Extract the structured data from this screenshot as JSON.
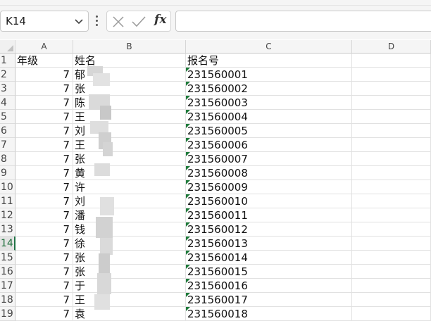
{
  "name_box": {
    "value": "K14"
  },
  "formula_bar": {
    "fx_label": "fx",
    "value": ""
  },
  "columns": [
    "A",
    "B",
    "C",
    "D"
  ],
  "active_row": "14",
  "header_row": {
    "row": "1",
    "a": "年级",
    "b": "姓名",
    "c": "报名号"
  },
  "rows": [
    {
      "row": "2",
      "a": "7",
      "b": "郁",
      "c": "231560001"
    },
    {
      "row": "3",
      "a": "7",
      "b": "张",
      "c": "231560002"
    },
    {
      "row": "4",
      "a": "7",
      "b": "陈",
      "c": "231560003"
    },
    {
      "row": "5",
      "a": "7",
      "b": "王",
      "c": "231560004"
    },
    {
      "row": "6",
      "a": "7",
      "b": "刘",
      "c": "231560005"
    },
    {
      "row": "7",
      "a": "7",
      "b": "王",
      "c": "231560006"
    },
    {
      "row": "8",
      "a": "7",
      "b": "张",
      "c": "231560007"
    },
    {
      "row": "9",
      "a": "7",
      "b": "黄",
      "c": "231560008"
    },
    {
      "row": "10",
      "a": "7",
      "b": "许",
      "c": "231560009"
    },
    {
      "row": "11",
      "a": "7",
      "b": "刘",
      "c": "231560010"
    },
    {
      "row": "12",
      "a": "7",
      "b": "潘",
      "c": "231560011"
    },
    {
      "row": "13",
      "a": "7",
      "b": "钱",
      "c": "231560012"
    },
    {
      "row": "14",
      "a": "7",
      "b": "徐",
      "c": "231560013"
    },
    {
      "row": "15",
      "a": "7",
      "b": "张",
      "c": "231560014"
    },
    {
      "row": "16",
      "a": "7",
      "b": "张",
      "c": "231560015"
    },
    {
      "row": "17",
      "a": "7",
      "b": "于",
      "c": "231560016"
    },
    {
      "row": "18",
      "a": "7",
      "b": "王",
      "c": "231560017"
    },
    {
      "row": "19",
      "a": "7",
      "b": "袁",
      "c": "231560018"
    }
  ],
  "colors": {
    "accent": "#217346",
    "text_marker": "#1e7a3a",
    "grid": "#e1e1e1",
    "header_bg": "#f5f5f5"
  },
  "icons": [
    "chevron-down-icon",
    "more-vert-icon",
    "cancel-icon",
    "check-icon",
    "fx-icon"
  ]
}
